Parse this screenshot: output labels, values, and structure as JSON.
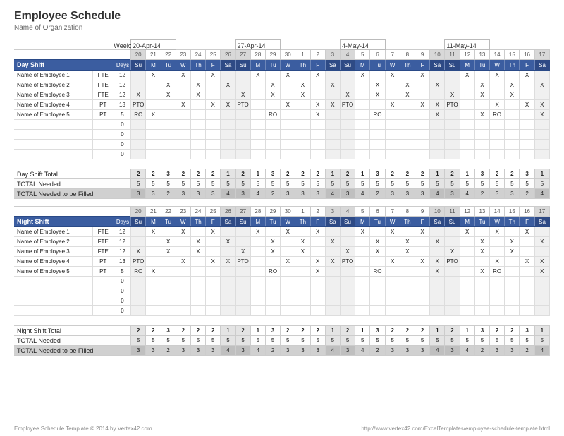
{
  "title": "Employee Schedule",
  "organization": "Name of Organization",
  "week_label": "Week:",
  "weeks": [
    "20-Apr-14",
    "27-Apr-14",
    "4-May-14",
    "11-May-14"
  ],
  "day_nums": [
    "20",
    "21",
    "22",
    "23",
    "24",
    "25",
    "26",
    "27",
    "28",
    "29",
    "30",
    "1",
    "2",
    "3",
    "4",
    "5",
    "6",
    "7",
    "8",
    "9",
    "10",
    "11",
    "12",
    "13",
    "14",
    "15",
    "16",
    "17"
  ],
  "dow": [
    "Su",
    "M",
    "Tu",
    "W",
    "Th",
    "F",
    "Sa",
    "Su",
    "M",
    "Tu",
    "W",
    "Th",
    "F",
    "Sa",
    "Su",
    "M",
    "Tu",
    "W",
    "Th",
    "F",
    "Sa",
    "Su",
    "M",
    "Tu",
    "W",
    "Th",
    "F",
    "Sa"
  ],
  "weekend": [
    true,
    false,
    false,
    false,
    false,
    false,
    true,
    true,
    false,
    false,
    false,
    false,
    false,
    true,
    true,
    false,
    false,
    false,
    false,
    false,
    true,
    true,
    false,
    false,
    false,
    false,
    false,
    true
  ],
  "col_labels": {
    "days": "Days"
  },
  "shifts": [
    {
      "name": "Day Shift",
      "employees": [
        {
          "name": "Name of Employee 1",
          "type": "FTE",
          "days": "12",
          "cells": [
            "",
            "X",
            "",
            "X",
            "",
            "X",
            "",
            "",
            "X",
            "",
            "X",
            "",
            "X",
            "",
            "",
            "X",
            "",
            "X",
            "",
            "X",
            "",
            "",
            "X",
            "",
            "X",
            "",
            "X",
            ""
          ]
        },
        {
          "name": "Name of Employee 2",
          "type": "FTE",
          "days": "12",
          "cells": [
            "",
            "",
            "X",
            "",
            "X",
            "",
            "X",
            "",
            "",
            "X",
            "",
            "X",
            "",
            "X",
            "",
            "",
            "X",
            "",
            "X",
            "",
            "X",
            "",
            "",
            "X",
            "",
            "X",
            "",
            "X"
          ]
        },
        {
          "name": "Name of Employee 3",
          "type": "FTE",
          "days": "12",
          "cells": [
            "X",
            "",
            "X",
            "",
            "X",
            "",
            "",
            "X",
            "",
            "X",
            "",
            "X",
            "",
            "",
            "X",
            "",
            "X",
            "",
            "X",
            "",
            "",
            "X",
            "",
            "X",
            "",
            "X",
            "",
            ""
          ]
        },
        {
          "name": "Name of Employee 4",
          "type": "PT",
          "days": "13",
          "cells": [
            "PTO",
            "",
            "",
            "X",
            "",
            "X",
            "X",
            "PTO",
            "",
            "",
            "X",
            "",
            "X",
            "X",
            "PTO",
            "",
            "",
            "X",
            "",
            "X",
            "X",
            "PTO",
            "",
            "",
            "X",
            "",
            "X",
            "X"
          ]
        },
        {
          "name": "Name of Employee 5",
          "type": "PT",
          "days": "5",
          "cells": [
            "RO",
            "X",
            "",
            "",
            "",
            "",
            "",
            "",
            "",
            "RO",
            "",
            "",
            "X",
            "",
            "",
            "",
            "RO",
            "",
            "",
            "",
            "X",
            "",
            "",
            "X",
            "RO",
            "",
            "",
            "X"
          ]
        }
      ],
      "empty_rows": 4,
      "totals": {
        "label": "Day Shift Total",
        "shift": [
          "2",
          "2",
          "3",
          "2",
          "2",
          "2",
          "1",
          "2",
          "1",
          "3",
          "2",
          "2",
          "2",
          "1",
          "2",
          "1",
          "3",
          "2",
          "2",
          "2",
          "1",
          "2",
          "1",
          "3",
          "2",
          "2",
          "3",
          "1"
        ],
        "needed_label": "TOTAL Needed",
        "needed": [
          "5",
          "5",
          "5",
          "5",
          "5",
          "5",
          "5",
          "5",
          "5",
          "5",
          "5",
          "5",
          "5",
          "5",
          "5",
          "5",
          "5",
          "5",
          "5",
          "5",
          "5",
          "5",
          "5",
          "5",
          "5",
          "5",
          "5",
          "5"
        ],
        "fill_label": "TOTAL Needed to be Filled",
        "fill": [
          "3",
          "3",
          "2",
          "3",
          "3",
          "3",
          "4",
          "3",
          "4",
          "2",
          "3",
          "3",
          "3",
          "4",
          "3",
          "4",
          "2",
          "3",
          "3",
          "3",
          "4",
          "3",
          "4",
          "2",
          "3",
          "3",
          "2",
          "4"
        ]
      }
    },
    {
      "name": "Night Shift",
      "employees": [
        {
          "name": "Name of Employee 1",
          "type": "FTE",
          "days": "12",
          "cells": [
            "",
            "X",
            "",
            "X",
            "",
            "X",
            "",
            "",
            "X",
            "",
            "X",
            "",
            "X",
            "",
            "",
            "X",
            "",
            "X",
            "",
            "X",
            "",
            "",
            "X",
            "",
            "X",
            "",
            "X",
            ""
          ]
        },
        {
          "name": "Name of Employee 2",
          "type": "FTE",
          "days": "12",
          "cells": [
            "",
            "",
            "X",
            "",
            "X",
            "",
            "X",
            "",
            "",
            "X",
            "",
            "X",
            "",
            "X",
            "",
            "",
            "X",
            "",
            "X",
            "",
            "X",
            "",
            "",
            "X",
            "",
            "X",
            "",
            "X"
          ]
        },
        {
          "name": "Name of Employee 3",
          "type": "FTE",
          "days": "12",
          "cells": [
            "X",
            "",
            "X",
            "",
            "X",
            "",
            "",
            "X",
            "",
            "X",
            "",
            "X",
            "",
            "",
            "X",
            "",
            "X",
            "",
            "X",
            "",
            "",
            "X",
            "",
            "X",
            "",
            "X",
            "",
            ""
          ]
        },
        {
          "name": "Name of Employee 4",
          "type": "PT",
          "days": "13",
          "cells": [
            "PTO",
            "",
            "",
            "X",
            "",
            "X",
            "X",
            "PTO",
            "",
            "",
            "X",
            "",
            "X",
            "X",
            "PTO",
            "",
            "",
            "X",
            "",
            "X",
            "X",
            "PTO",
            "",
            "",
            "X",
            "",
            "X",
            "X"
          ]
        },
        {
          "name": "Name of Employee 5",
          "type": "PT",
          "days": "5",
          "cells": [
            "RO",
            "X",
            "",
            "",
            "",
            "",
            "",
            "",
            "",
            "RO",
            "",
            "",
            "X",
            "",
            "",
            "",
            "RO",
            "",
            "",
            "",
            "X",
            "",
            "",
            "X",
            "RO",
            "",
            "",
            "X"
          ]
        }
      ],
      "empty_rows": 4,
      "totals": {
        "label": "Night Shift Total",
        "shift": [
          "2",
          "2",
          "3",
          "2",
          "2",
          "2",
          "1",
          "2",
          "1",
          "3",
          "2",
          "2",
          "2",
          "1",
          "2",
          "1",
          "3",
          "2",
          "2",
          "2",
          "1",
          "2",
          "1",
          "3",
          "2",
          "2",
          "3",
          "1"
        ],
        "needed_label": "TOTAL Needed",
        "needed": [
          "5",
          "5",
          "5",
          "5",
          "5",
          "5",
          "5",
          "5",
          "5",
          "5",
          "5",
          "5",
          "5",
          "5",
          "5",
          "5",
          "5",
          "5",
          "5",
          "5",
          "5",
          "5",
          "5",
          "5",
          "5",
          "5",
          "5",
          "5"
        ],
        "fill_label": "TOTAL Needed to be Filled",
        "fill": [
          "3",
          "3",
          "2",
          "3",
          "3",
          "3",
          "4",
          "3",
          "4",
          "2",
          "3",
          "3",
          "3",
          "4",
          "3",
          "4",
          "2",
          "3",
          "3",
          "3",
          "4",
          "3",
          "4",
          "2",
          "3",
          "3",
          "2",
          "4"
        ]
      }
    }
  ],
  "footer": {
    "left": "Employee Schedule Template © 2014 by Vertex42.com",
    "right": "http://www.vertex42.com/ExcelTemplates/employee-schedule-template.html"
  }
}
